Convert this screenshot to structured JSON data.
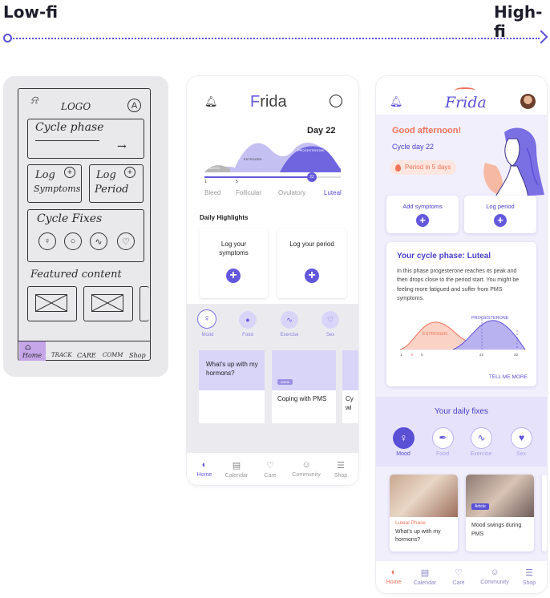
{
  "header": {
    "low_label": "Low-fi",
    "high_label": "High-fi"
  },
  "lowfi": {
    "logo": "LOGO",
    "avatar": "A",
    "cycle_phase": "Cycle phase",
    "log_symptoms": [
      "Log",
      "Symptoms"
    ],
    "log_period": [
      "Log",
      "Period"
    ],
    "cycle_fixes": "Cycle Fixes",
    "featured": "Featured content",
    "nav": [
      "Home",
      "TRACK",
      "CARE",
      "COMM",
      "Shop"
    ]
  },
  "midfi": {
    "logo_first": "F",
    "logo_rest": "rida",
    "day": "Day 22",
    "chart_labels": {
      "estrogen": "ESTROGEN",
      "progesterone": "PROGESTERONE",
      "bleed_small": "BLEED"
    },
    "slider": {
      "start": "1",
      "mark": "5",
      "current": "22"
    },
    "phases": [
      "Bleed",
      "Follicular",
      "Ovulatory",
      "Luteal"
    ],
    "daily_highlights": "Daily Highlights",
    "card1": "Log your symptoms",
    "card2": "Log your period",
    "fixes": [
      "Mood",
      "Food",
      "Exercise",
      "Sex"
    ],
    "article1": "What's up with my hormons?",
    "article_badge": "Article",
    "article2": "Coping with PMS",
    "article3_partial": "Cy wi",
    "nav": [
      "Home",
      "Calendar",
      "Care",
      "Community",
      "Shop"
    ]
  },
  "hifi": {
    "logo": "Frida",
    "greeting": "Good afternoon!",
    "cycle_day": "Cycle day 22",
    "period_in": "Period in 5 days",
    "add_symptoms": "Add symptoms",
    "log_period": "Log period",
    "phase_title": "Your cycle phase: Luteal",
    "phase_text": "In this phase progesterone reaches its peak and then drops close to the period start. You might be feeling more fatigued and suffer from PMS symptoms.",
    "chart_labels": {
      "estrogen": "ESTROGEN",
      "progesterone": "PROGESTERONE"
    },
    "axis": [
      "1",
      "6",
      "5",
      "22",
      "32"
    ],
    "tell_me_more": "TELL ME MORE",
    "daily_fixes": "Your daily fixes",
    "fixes": [
      "Mood",
      "Food",
      "Exercise",
      "Sex"
    ],
    "article1_tag": "Luteal Phase",
    "article1_title": "What's up with my hormons?",
    "article2_badge": "Article",
    "article2_title": "Mood swings during PMS",
    "nav": [
      "Home",
      "Calendar",
      "Care",
      "Community",
      "Shop"
    ]
  },
  "colors": {
    "accent": "#6358dc",
    "accent_light": "#dedbfb",
    "coral": "#f0735a",
    "hi_bg": "#f1effc"
  }
}
